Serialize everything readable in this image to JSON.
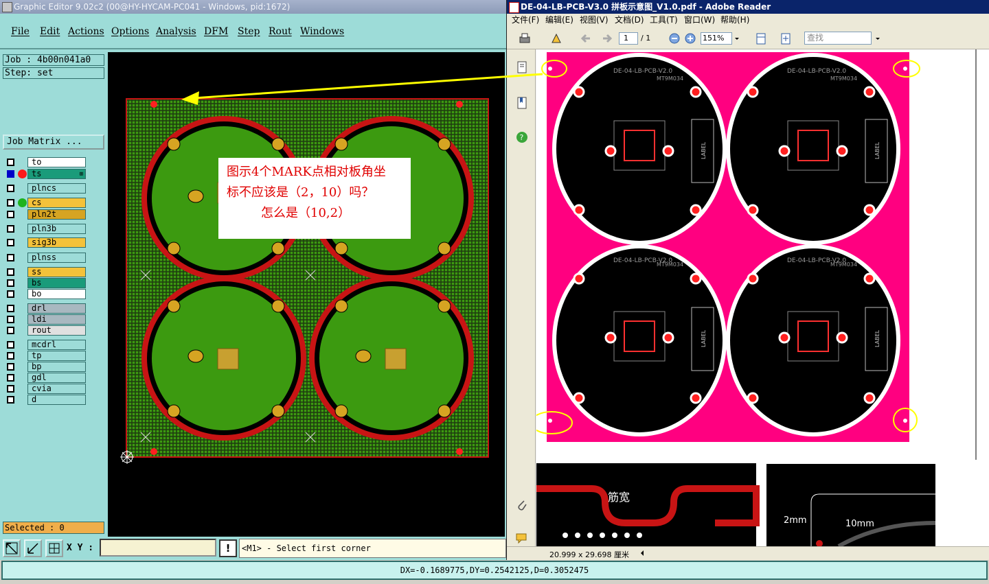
{
  "graphic_editor": {
    "title": "Graphic Editor 9.02c2 (00@HY-HYCAM-PC041 - Windows, pid:1672)",
    "menu": [
      "File",
      "Edit",
      "Actions",
      "Options",
      "Analysis",
      "DFM",
      "Step",
      "Rout",
      "Windows"
    ],
    "job": "Job : 4b00n041a0",
    "step": "Step: set",
    "job_matrix_label": "Job Matrix ...",
    "layers": [
      {
        "name": "to",
        "color": "#ffffff",
        "active": false,
        "dot": ""
      },
      {
        "name": "ts",
        "color": "#1a9b7a",
        "active": true,
        "dot": "#ff1a1a"
      },
      {
        "name": "plncs",
        "color": "#9ddcd8",
        "active": false,
        "dot": ""
      },
      {
        "name": "cs",
        "color": "#f4c23a",
        "active": false,
        "dot": "#1db31d"
      },
      {
        "name": "pln2t",
        "color": "#d6a422",
        "active": false,
        "dot": ""
      },
      {
        "name": "pln3b",
        "color": "#9ddcd8",
        "active": false,
        "dot": ""
      },
      {
        "name": "sig3b",
        "color": "#f4c23a",
        "active": false,
        "dot": ""
      },
      {
        "name": "plnss",
        "color": "#9ddcd8",
        "active": false,
        "dot": ""
      },
      {
        "name": "ss",
        "color": "#f4c23a",
        "active": false,
        "dot": ""
      },
      {
        "name": "bs",
        "color": "#1a9b7a",
        "active": false,
        "dot": ""
      },
      {
        "name": "bo",
        "color": "#ffffff",
        "active": false,
        "dot": ""
      },
      {
        "name": "drl",
        "color": "#a8b8c0",
        "active": false,
        "dot": ""
      },
      {
        "name": "ldi",
        "color": "#a8b8c0",
        "active": false,
        "dot": ""
      },
      {
        "name": "rout",
        "color": "#e0e0e0",
        "active": false,
        "dot": ""
      },
      {
        "name": "mcdrl",
        "color": "#9ddcd8",
        "active": false,
        "dot": ""
      },
      {
        "name": "tp",
        "color": "#9ddcd8",
        "active": false,
        "dot": ""
      },
      {
        "name": "bp",
        "color": "#9ddcd8",
        "active": false,
        "dot": ""
      },
      {
        "name": "gdl",
        "color": "#9ddcd8",
        "active": false,
        "dot": ""
      },
      {
        "name": "cvia",
        "color": "#9ddcd8",
        "active": false,
        "dot": ""
      },
      {
        "name": "d",
        "color": "#9ddcd8",
        "active": false,
        "dot": ""
      }
    ],
    "selected": "Selected : 0",
    "xy_label": "X Y :",
    "xy_value": "",
    "prompt": "<M1> - Select first corner",
    "annotation": [
      "图示4个MARK点相对板角坐",
      "标不应该是（2，10）吗？",
      "怎么是（10,2）"
    ]
  },
  "adobe_reader": {
    "title": "DE-04-LB-PCB-V3.0 拼板示意图_V1.0.pdf - Adobe Reader",
    "menu": [
      "文件(F)",
      "编辑(E)",
      "视图(V)",
      "文档(D)",
      "工具(T)",
      "窗口(W)",
      "帮助(H)"
    ],
    "page_current": "1",
    "page_total": "/ 1",
    "zoom": "151%",
    "find_placeholder": "查找",
    "doc_size": "20.999 x 29.698 厘米",
    "board_label_top": "DE-04-LB-PCB-V2.0",
    "board_label_model": "MT9M034",
    "board_label_side": "LABEL",
    "detail_left_label": "筋宽",
    "detail_right_label_a": "2mm",
    "detail_right_label_b": "10mm"
  },
  "status_bar": "DX=-0.1689775,DY=0.2542125,D=0.3052475",
  "colors": {
    "panel_teal": "#9ddcd8",
    "board_green": "#3c9a10",
    "board_red": "#c81414",
    "pdf_magenta": "#ff0080",
    "mark_yellow": "#ffff00",
    "annotation_red": "#e00000"
  }
}
